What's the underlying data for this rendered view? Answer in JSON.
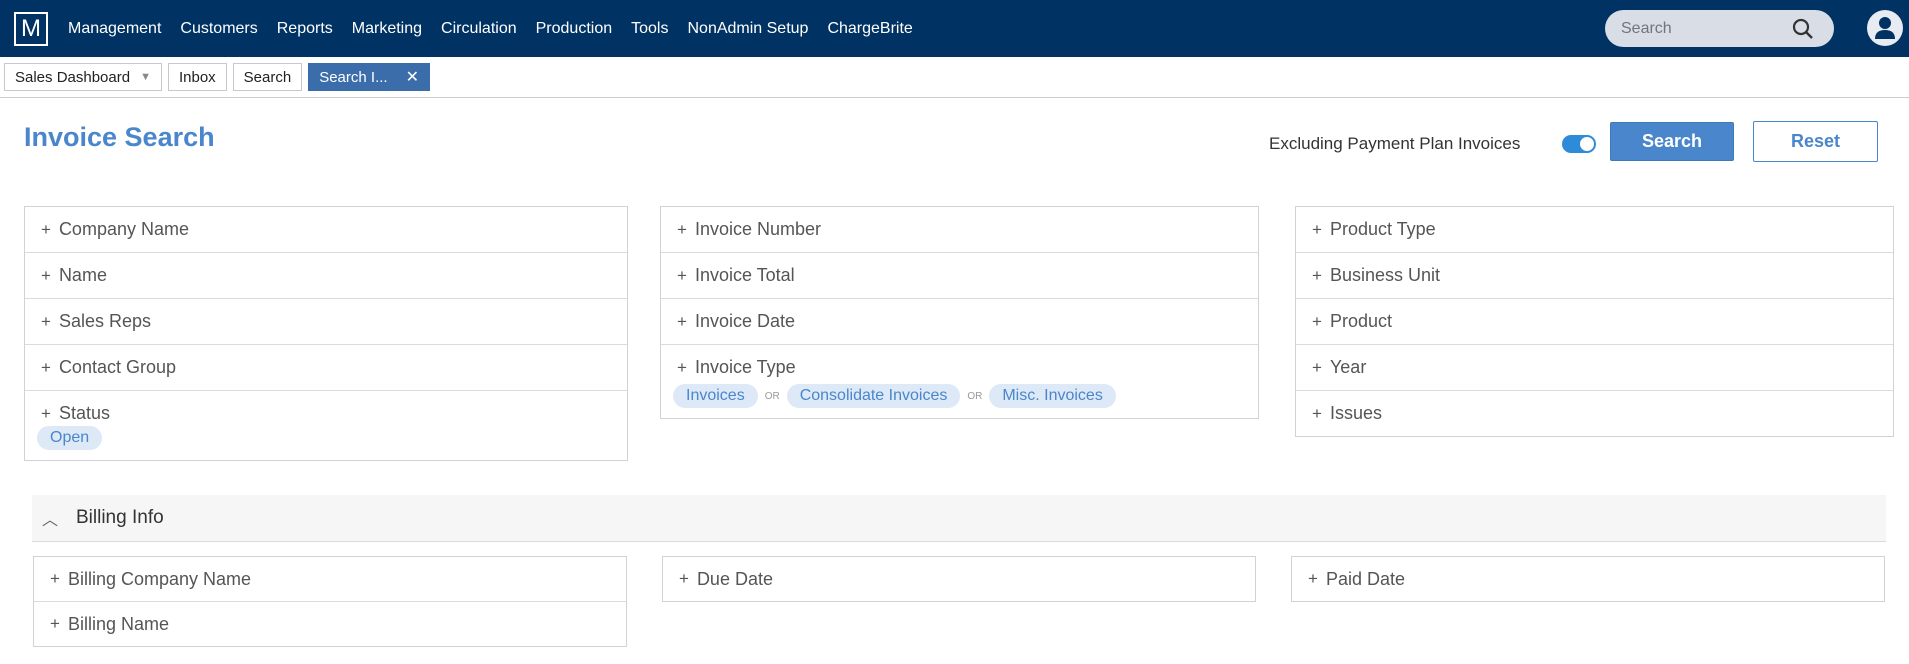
{
  "nav": {
    "logo": "M",
    "items": [
      "Management",
      "Customers",
      "Reports",
      "Marketing",
      "Circulation",
      "Production",
      "Tools",
      "NonAdmin Setup",
      "ChargeBrite"
    ],
    "search_placeholder": "Search"
  },
  "tabs": [
    {
      "label": "Sales Dashboard"
    },
    {
      "label": "Inbox"
    },
    {
      "label": "Search"
    },
    {
      "label": "Search I..."
    }
  ],
  "page": {
    "title": "Invoice Search",
    "exclude_label": "Excluding Payment Plan Invoices",
    "exclude_enabled": true,
    "search_button": "Search",
    "reset_button": "Reset"
  },
  "filters": {
    "col1": [
      "Company Name",
      "Name",
      "Sales Reps",
      "Contact Group",
      "Status"
    ],
    "status_chips": [
      "Open"
    ],
    "col2": [
      "Invoice Number",
      "Invoice Total",
      "Invoice Date",
      "Invoice Type"
    ],
    "invoice_type_chips": [
      "Invoices",
      "Consolidate Invoices",
      "Misc. Invoices"
    ],
    "or_label": "OR",
    "col3": [
      "Product Type",
      "Business Unit",
      "Product",
      "Year",
      "Issues"
    ]
  },
  "billing": {
    "title": "Billing Info",
    "col1": [
      "Billing Company Name",
      "Billing Name"
    ],
    "col2": [
      "Due Date"
    ],
    "col3": [
      "Paid Date"
    ]
  },
  "colors": {
    "nav_bg": "#003263",
    "accent": "#4a86cc",
    "chip_bg": "#dde9f7"
  }
}
